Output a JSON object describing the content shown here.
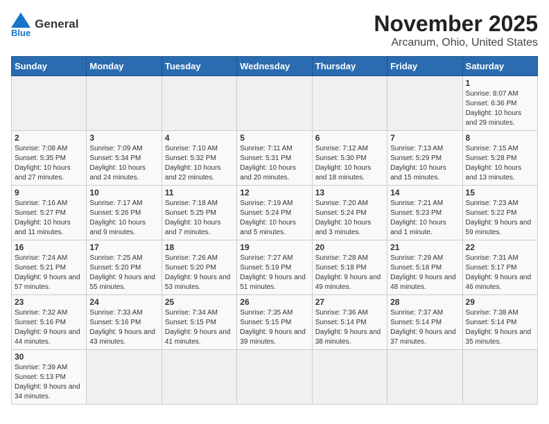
{
  "header": {
    "logo_general": "General",
    "logo_blue": "Blue",
    "title": "November 2025",
    "subtitle": "Arcanum, Ohio, United States"
  },
  "weekdays": [
    "Sunday",
    "Monday",
    "Tuesday",
    "Wednesday",
    "Thursday",
    "Friday",
    "Saturday"
  ],
  "weeks": [
    [
      {
        "day": "",
        "info": ""
      },
      {
        "day": "",
        "info": ""
      },
      {
        "day": "",
        "info": ""
      },
      {
        "day": "",
        "info": ""
      },
      {
        "day": "",
        "info": ""
      },
      {
        "day": "",
        "info": ""
      },
      {
        "day": "1",
        "info": "Sunrise: 8:07 AM\nSunset: 6:36 PM\nDaylight: 10 hours and 29 minutes."
      }
    ],
    [
      {
        "day": "2",
        "info": "Sunrise: 7:08 AM\nSunset: 5:35 PM\nDaylight: 10 hours and 27 minutes."
      },
      {
        "day": "3",
        "info": "Sunrise: 7:09 AM\nSunset: 5:34 PM\nDaylight: 10 hours and 24 minutes."
      },
      {
        "day": "4",
        "info": "Sunrise: 7:10 AM\nSunset: 5:32 PM\nDaylight: 10 hours and 22 minutes."
      },
      {
        "day": "5",
        "info": "Sunrise: 7:11 AM\nSunset: 5:31 PM\nDaylight: 10 hours and 20 minutes."
      },
      {
        "day": "6",
        "info": "Sunrise: 7:12 AM\nSunset: 5:30 PM\nDaylight: 10 hours and 18 minutes."
      },
      {
        "day": "7",
        "info": "Sunrise: 7:13 AM\nSunset: 5:29 PM\nDaylight: 10 hours and 15 minutes."
      },
      {
        "day": "8",
        "info": "Sunrise: 7:15 AM\nSunset: 5:28 PM\nDaylight: 10 hours and 13 minutes."
      }
    ],
    [
      {
        "day": "9",
        "info": "Sunrise: 7:16 AM\nSunset: 5:27 PM\nDaylight: 10 hours and 11 minutes."
      },
      {
        "day": "10",
        "info": "Sunrise: 7:17 AM\nSunset: 5:26 PM\nDaylight: 10 hours and 9 minutes."
      },
      {
        "day": "11",
        "info": "Sunrise: 7:18 AM\nSunset: 5:25 PM\nDaylight: 10 hours and 7 minutes."
      },
      {
        "day": "12",
        "info": "Sunrise: 7:19 AM\nSunset: 5:24 PM\nDaylight: 10 hours and 5 minutes."
      },
      {
        "day": "13",
        "info": "Sunrise: 7:20 AM\nSunset: 5:24 PM\nDaylight: 10 hours and 3 minutes."
      },
      {
        "day": "14",
        "info": "Sunrise: 7:21 AM\nSunset: 5:23 PM\nDaylight: 10 hours and 1 minute."
      },
      {
        "day": "15",
        "info": "Sunrise: 7:23 AM\nSunset: 5:22 PM\nDaylight: 9 hours and 59 minutes."
      }
    ],
    [
      {
        "day": "16",
        "info": "Sunrise: 7:24 AM\nSunset: 5:21 PM\nDaylight: 9 hours and 57 minutes."
      },
      {
        "day": "17",
        "info": "Sunrise: 7:25 AM\nSunset: 5:20 PM\nDaylight: 9 hours and 55 minutes."
      },
      {
        "day": "18",
        "info": "Sunrise: 7:26 AM\nSunset: 5:20 PM\nDaylight: 9 hours and 53 minutes."
      },
      {
        "day": "19",
        "info": "Sunrise: 7:27 AM\nSunset: 5:19 PM\nDaylight: 9 hours and 51 minutes."
      },
      {
        "day": "20",
        "info": "Sunrise: 7:28 AM\nSunset: 5:18 PM\nDaylight: 9 hours and 49 minutes."
      },
      {
        "day": "21",
        "info": "Sunrise: 7:29 AM\nSunset: 5:18 PM\nDaylight: 9 hours and 48 minutes."
      },
      {
        "day": "22",
        "info": "Sunrise: 7:31 AM\nSunset: 5:17 PM\nDaylight: 9 hours and 46 minutes."
      }
    ],
    [
      {
        "day": "23",
        "info": "Sunrise: 7:32 AM\nSunset: 5:16 PM\nDaylight: 9 hours and 44 minutes."
      },
      {
        "day": "24",
        "info": "Sunrise: 7:33 AM\nSunset: 5:16 PM\nDaylight: 9 hours and 43 minutes."
      },
      {
        "day": "25",
        "info": "Sunrise: 7:34 AM\nSunset: 5:15 PM\nDaylight: 9 hours and 41 minutes."
      },
      {
        "day": "26",
        "info": "Sunrise: 7:35 AM\nSunset: 5:15 PM\nDaylight: 9 hours and 39 minutes."
      },
      {
        "day": "27",
        "info": "Sunrise: 7:36 AM\nSunset: 5:14 PM\nDaylight: 9 hours and 38 minutes."
      },
      {
        "day": "28",
        "info": "Sunrise: 7:37 AM\nSunset: 5:14 PM\nDaylight: 9 hours and 37 minutes."
      },
      {
        "day": "29",
        "info": "Sunrise: 7:38 AM\nSunset: 5:14 PM\nDaylight: 9 hours and 35 minutes."
      }
    ],
    [
      {
        "day": "30",
        "info": "Sunrise: 7:39 AM\nSunset: 5:13 PM\nDaylight: 9 hours and 34 minutes."
      },
      {
        "day": "",
        "info": ""
      },
      {
        "day": "",
        "info": ""
      },
      {
        "day": "",
        "info": ""
      },
      {
        "day": "",
        "info": ""
      },
      {
        "day": "",
        "info": ""
      },
      {
        "day": "",
        "info": ""
      }
    ]
  ]
}
